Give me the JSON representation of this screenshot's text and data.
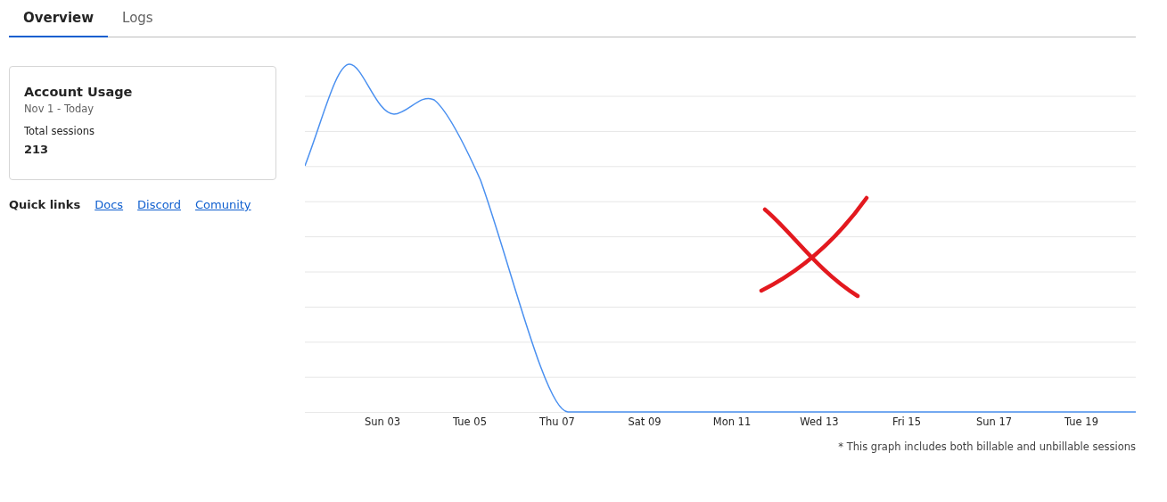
{
  "tabs": [
    {
      "label": "Overview",
      "selected": true
    },
    {
      "label": "Logs",
      "selected": false
    }
  ],
  "usage_card": {
    "title": "Account Usage",
    "period": "Nov 1 - Today",
    "metric_label": "Total sessions",
    "metric_value": "213"
  },
  "quick_links": {
    "label": "Quick links",
    "links": [
      "Docs",
      "Discord",
      "Comunity"
    ]
  },
  "chart": {
    "x_labels": [
      "Sun 03",
      "Tue 05",
      "Thu 07",
      "Sat 09",
      "Mon 11",
      "Wed 13",
      "Fri 15",
      "Sun 17",
      "Tue 19"
    ],
    "note": "* This graph includes both billable and unbillable sessions"
  }
}
